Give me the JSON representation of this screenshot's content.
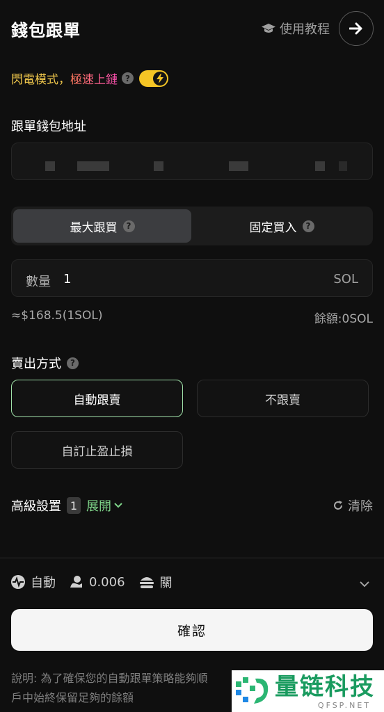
{
  "header": {
    "title": "錢包跟單",
    "tutorial_label": "使用教程"
  },
  "flash": {
    "label_a": "閃電模式，",
    "label_b": "極速上鏈",
    "enabled": true
  },
  "wallet": {
    "label": "跟單錢包地址"
  },
  "mode_tabs": [
    {
      "label": "最大跟買",
      "active": true
    },
    {
      "label": "固定買入",
      "active": false
    }
  ],
  "quantity": {
    "label": "數量",
    "value": "1",
    "unit": "SOL"
  },
  "conversion": "≈$168.5(1SOL)",
  "balance": "餘額:0SOL",
  "sell": {
    "label": "賣出方式",
    "options": [
      {
        "label": "自動跟賣",
        "selected": true
      },
      {
        "label": "不跟賣",
        "selected": false
      },
      {
        "label": "自訂止盈止損",
        "selected": false
      }
    ]
  },
  "advanced": {
    "label": "高級設置",
    "count": "1",
    "expand": "展開",
    "clear": "清除"
  },
  "footer_stats": {
    "mode": "自動",
    "fee": "0.006",
    "mev": "關"
  },
  "confirm_label": "確認",
  "note_line1": "說明: 為了確保您的自動跟單策略能夠順",
  "note_line2": "戶中始終保留足夠的餘額",
  "watermark": {
    "brand": "量链科技",
    "domain": "QFSP.NET"
  },
  "colors": {
    "accent_yellow": "#f5c525",
    "accent_green": "#7fd58a",
    "selected_border": "#9fe0a8"
  }
}
